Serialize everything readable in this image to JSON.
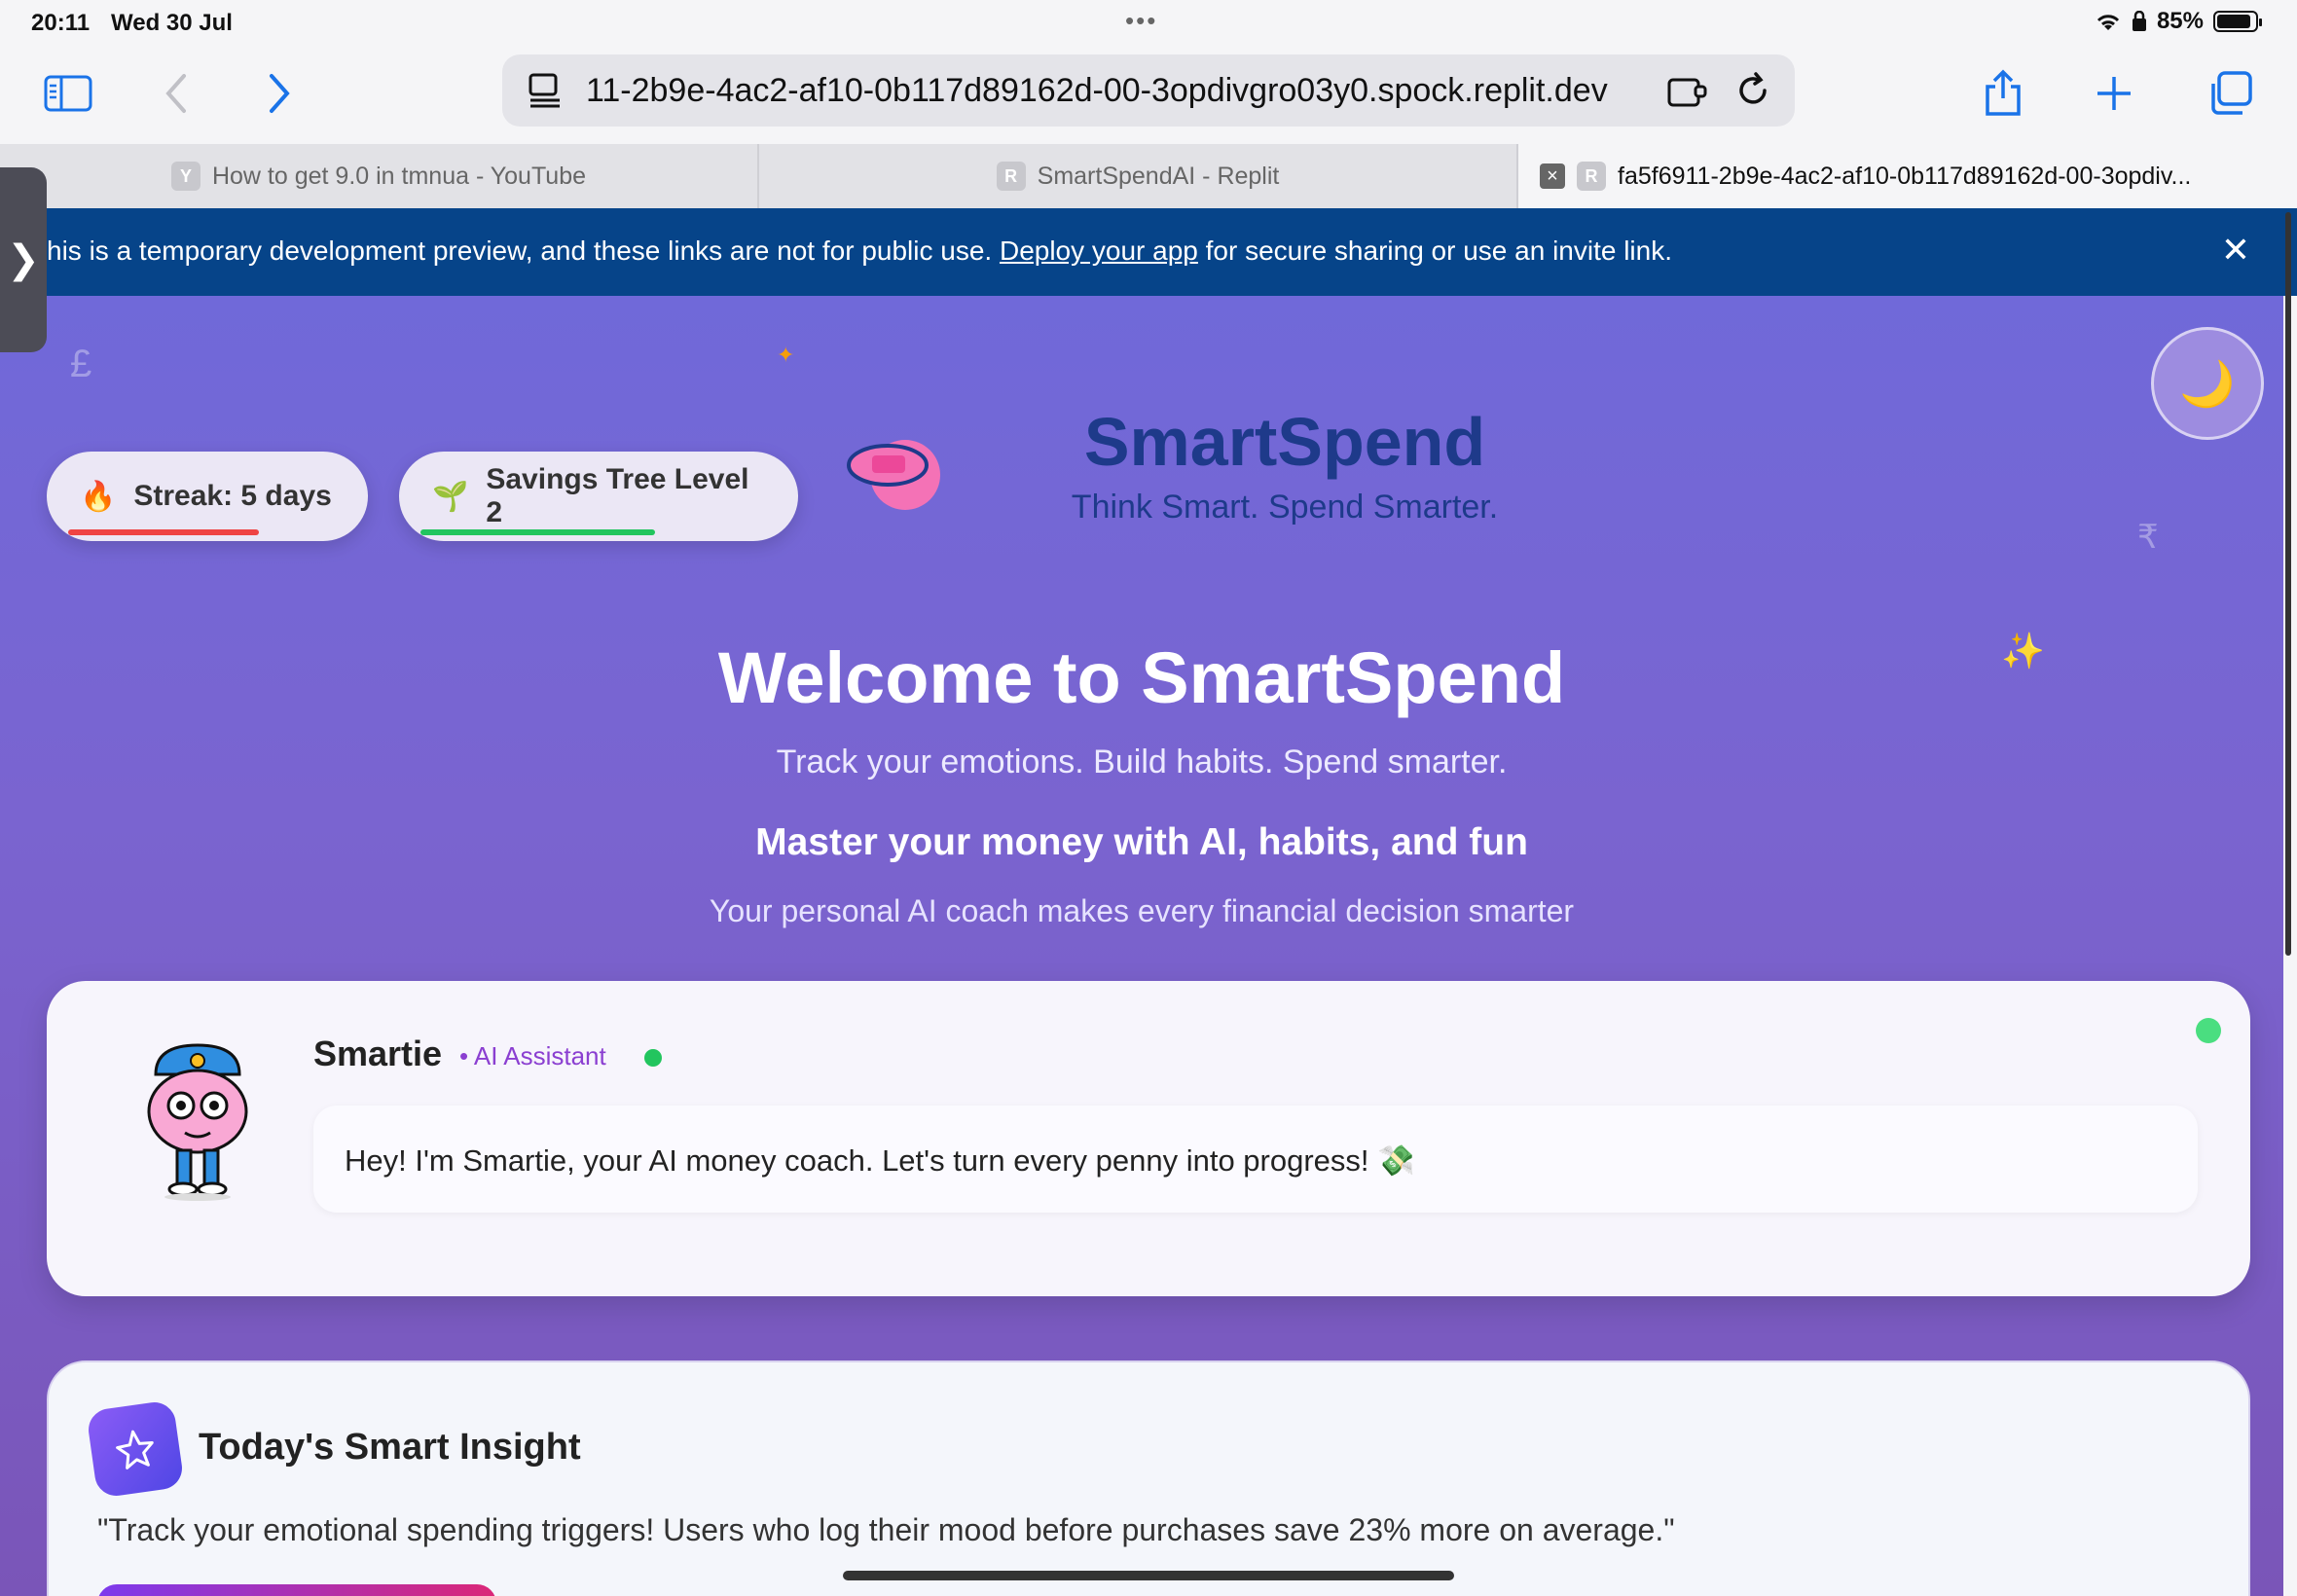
{
  "status_bar": {
    "time": "20:11",
    "date": "Wed 30 Jul",
    "battery": "85%"
  },
  "browser": {
    "url": "11-2b9e-4ac2-af10-0b117d89162d-00-3opdivgro03y0.spock.replit.dev",
    "tabs": [
      {
        "favicon": "Y",
        "label": "How to get 9.0 in tmnua - YouTube"
      },
      {
        "favicon": "R",
        "label": "SmartSpendAI - Replit"
      },
      {
        "favicon": "R",
        "label": "fa5f6911-2b9e-4ac2-af10-0b117d89162d-00-3opdiv..."
      }
    ]
  },
  "banner": {
    "text_before": "his is a temporary development preview, and these links are not for public use. ",
    "link": "Deploy your app",
    "text_after": " for secure sharing or use an invite link."
  },
  "gamification": {
    "streak": {
      "emoji": "🔥",
      "label": "Streak: 5 days",
      "progress": 0.7,
      "color": "#ef4444"
    },
    "savings": {
      "emoji": "🌱",
      "label": "Savings Tree Level 2",
      "progress": 0.65,
      "color": "#22c55e"
    }
  },
  "brand": {
    "title": "SmartSpend",
    "tagline": "Think Smart. Spend Smarter."
  },
  "hero": {
    "title": "Welcome to SmartSpend",
    "subtitle": "Track your emotions. Build habits. Spend smarter.",
    "headline": "Master your money with AI, habits, and fun",
    "description": "Your personal AI coach makes every financial decision smarter"
  },
  "assistant": {
    "name": "Smartie",
    "role": "• AI Assistant",
    "message": "Hey! I'm Smartie, your AI money coach. Let's turn every penny into progress! 💸"
  },
  "insight": {
    "title": "Today's Smart Insight",
    "text": "\"Track your emotional spending triggers! Users who log their mood before purchases save 23% more on average.\""
  },
  "icons": {
    "theme_toggle": "moon-icon",
    "insight": "sparkle-icon"
  },
  "colors": {
    "accent": "#7069d9",
    "brand": "#1e3a8a",
    "banner": "#064489"
  }
}
